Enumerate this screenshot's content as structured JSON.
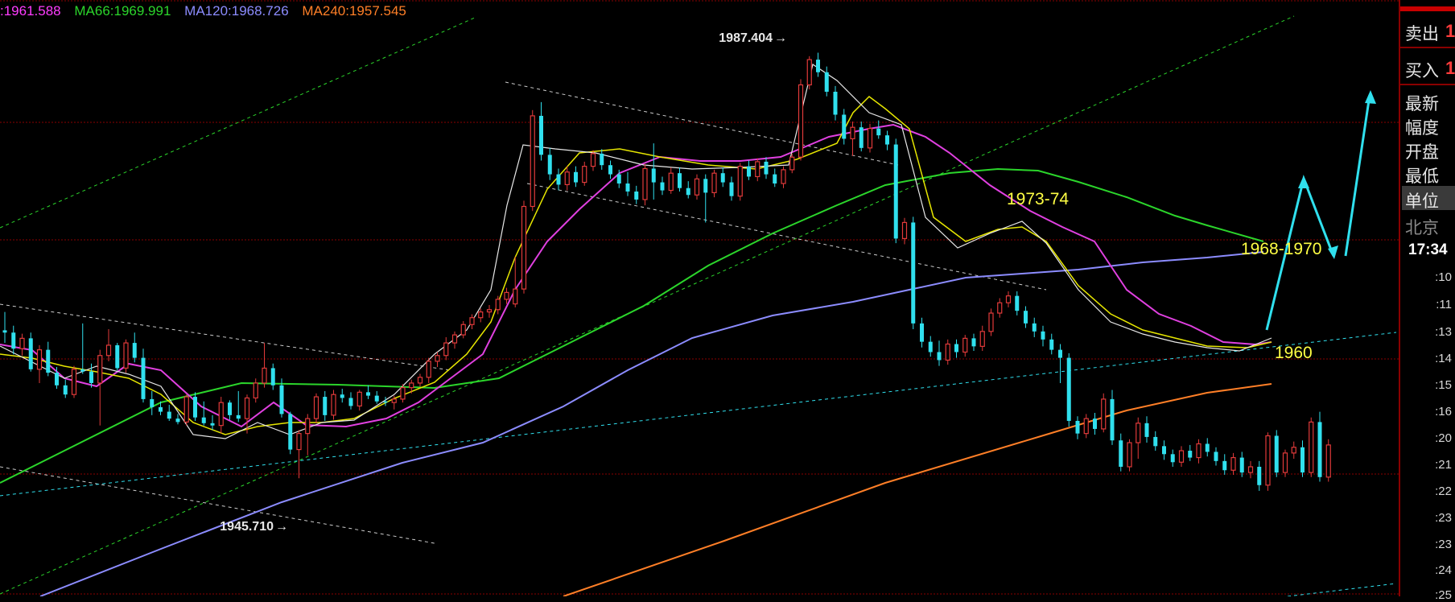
{
  "ma_legend": [
    {
      "text": ":1961.588",
      "color": "#ff3cff"
    },
    {
      "text": "MA66:1969.991",
      "color": "#2bd52b"
    },
    {
      "text": "MA120:1968.726",
      "color": "#8c8cff"
    },
    {
      "text": "MA240:1957.545",
      "color": "#ff7f27"
    }
  ],
  "price_labels": {
    "high": "1987.404",
    "low": "1945.710"
  },
  "annotations": {
    "a1": "1973-74",
    "a2": "1968-1970",
    "a3": "1960"
  },
  "side_panel": {
    "sell": "卖出",
    "buy": "买入",
    "sell_value": "1",
    "buy_value": "1",
    "latest": "最新",
    "change": "幅度",
    "open": "开盘",
    "low": "最低",
    "unit": "单位",
    "beijing": "北京",
    "time": "17:34",
    "ticks": [
      ":10",
      ":11",
      ":13",
      ":14",
      ":15",
      ":16",
      ":20",
      ":21",
      ":22",
      ":23",
      ":23",
      ":24",
      ":25"
    ]
  },
  "colors": {
    "background": "#000000",
    "up": "#e23a3a",
    "down": "#30e0ee",
    "grid": "#8a0000",
    "ma_white": "#e8e8e8",
    "ma_yellow": "#e6e600",
    "ma_magenta": "#e040e0",
    "ma66": "#2bd52b",
    "ma120": "#8c8cff",
    "ma240": "#ff7f27",
    "channel_green": "#2bd52b",
    "channel_white": "#cccccc",
    "trend_cyan": "#30e0ee",
    "annotation": "#ffff44",
    "arrow": "#30e0ee"
  },
  "chart_data": {
    "type": "candlestick",
    "instrument_price_range": [
      1940,
      1992
    ],
    "annotations": [
      "1987.404",
      "1945.710",
      "1973-74",
      "1968-1970",
      "1960"
    ],
    "ma_series": [
      {
        "name": "MA66",
        "last": 1969.991
      },
      {
        "name": "MA120",
        "last": 1968.726
      },
      {
        "name": "MA240",
        "last": 1957.545
      }
    ],
    "candles": [
      [
        1963.2,
        1964.8,
        1962.1,
        1963.0
      ],
      [
        1963.0,
        1963.6,
        1961.1,
        1961.6
      ],
      [
        1961.6,
        1962.9,
        1961.0,
        1962.5
      ],
      [
        1962.5,
        1963.0,
        1959.6,
        1959.8
      ],
      [
        1959.8,
        1961.9,
        1958.6,
        1961.5
      ],
      [
        1961.5,
        1962.2,
        1959.2,
        1959.5
      ],
      [
        1959.5,
        1960.0,
        1958.1,
        1958.4
      ],
      [
        1958.4,
        1958.9,
        1957.3,
        1957.6
      ],
      [
        1957.6,
        1960.1,
        1957.3,
        1959.8
      ],
      [
        1959.8,
        1963.8,
        1959.4,
        1959.6
      ],
      [
        1959.6,
        1960.3,
        1958.2,
        1958.6
      ],
      [
        1958.6,
        1961.5,
        1954.9,
        1961.0
      ],
      [
        1961.0,
        1963.3,
        1960.5,
        1961.9
      ],
      [
        1961.9,
        1962.1,
        1959.7,
        1959.9
      ],
      [
        1959.9,
        1962.4,
        1959.5,
        1962.1
      ],
      [
        1962.1,
        1963.0,
        1960.4,
        1960.8
      ],
      [
        1960.8,
        1961.6,
        1956.9,
        1957.2
      ],
      [
        1957.2,
        1957.9,
        1955.8,
        1956.5
      ],
      [
        1956.5,
        1957.0,
        1955.8,
        1956.1
      ],
      [
        1956.1,
        1956.7,
        1955.3,
        1955.5
      ],
      [
        1955.5,
        1955.9,
        1955.0,
        1955.2
      ],
      [
        1955.2,
        1957.6,
        1954.9,
        1957.4
      ],
      [
        1957.4,
        1957.8,
        1955.3,
        1955.6
      ],
      [
        1955.6,
        1957.0,
        1954.9,
        1955.1
      ],
      [
        1955.1,
        1955.8,
        1954.5,
        1954.9
      ],
      [
        1954.9,
        1957.4,
        1954.2,
        1956.9
      ],
      [
        1956.9,
        1957.1,
        1955.4,
        1955.8
      ],
      [
        1955.8,
        1957.9,
        1955.2,
        1955.5
      ],
      [
        1955.5,
        1957.6,
        1954.2,
        1957.3
      ],
      [
        1957.3,
        1959.0,
        1956.9,
        1958.6
      ],
      [
        1958.6,
        1962.1,
        1958.2,
        1959.9
      ],
      [
        1959.9,
        1960.3,
        1958.0,
        1958.4
      ],
      [
        1958.4,
        1959.0,
        1955.6,
        1955.9
      ],
      [
        1955.9,
        1956.1,
        1952.4,
        1952.8
      ],
      [
        1952.8,
        1954.5,
        1950.3,
        1954.2
      ],
      [
        1954.2,
        1955.9,
        1952.3,
        1955.5
      ],
      [
        1955.5,
        1957.7,
        1955.1,
        1957.4
      ],
      [
        1957.4,
        1957.9,
        1955.3,
        1955.8
      ],
      [
        1955.8,
        1958.0,
        1955.4,
        1957.6
      ],
      [
        1957.6,
        1958.1,
        1956.9,
        1957.3
      ],
      [
        1957.3,
        1957.8,
        1956.3,
        1956.6
      ],
      [
        1956.6,
        1958.0,
        1956.2,
        1957.8
      ],
      [
        1957.8,
        1958.4,
        1957.2,
        1957.5
      ],
      [
        1957.5,
        1957.9,
        1956.8,
        1957.0
      ],
      [
        1957.0,
        1957.4,
        1956.6,
        1956.9
      ],
      [
        1956.9,
        1957.5,
        1956.3,
        1957.2
      ],
      [
        1957.2,
        1958.5,
        1956.9,
        1958.2
      ],
      [
        1958.2,
        1958.9,
        1957.7,
        1958.6
      ],
      [
        1958.6,
        1959.4,
        1958.3,
        1959.1
      ],
      [
        1959.1,
        1960.8,
        1958.6,
        1960.5
      ],
      [
        1960.5,
        1961.3,
        1960.0,
        1961.0
      ],
      [
        1961.0,
        1962.6,
        1960.6,
        1962.1
      ],
      [
        1962.1,
        1963.1,
        1961.6,
        1962.8
      ],
      [
        1962.8,
        1964.0,
        1962.5,
        1963.7
      ],
      [
        1963.7,
        1964.6,
        1963.3,
        1964.3
      ],
      [
        1964.3,
        1965.1,
        1963.9,
        1964.8
      ],
      [
        1964.8,
        1965.4,
        1964.3,
        1965.0
      ],
      [
        1965.0,
        1966.2,
        1964.6,
        1965.9
      ],
      [
        1965.9,
        1966.9,
        1965.5,
        1966.5
      ],
      [
        1965.5,
        1969.6,
        1965.2,
        1966.8
      ],
      [
        1966.8,
        1974.5,
        1966.4,
        1974.0
      ],
      [
        1974.0,
        1982.4,
        1973.6,
        1981.9
      ],
      [
        1981.9,
        1983.1,
        1978.0,
        1978.5
      ],
      [
        1978.5,
        1979.1,
        1976.3,
        1976.8
      ],
      [
        1976.8,
        1977.3,
        1975.4,
        1975.9
      ],
      [
        1975.9,
        1977.5,
        1975.4,
        1977.0
      ],
      [
        1977.0,
        1977.5,
        1975.7,
        1976.1
      ],
      [
        1976.1,
        1977.9,
        1975.8,
        1977.5
      ],
      [
        1977.5,
        1978.9,
        1977.1,
        1978.6
      ],
      [
        1978.6,
        1979.0,
        1977.2,
        1977.6
      ],
      [
        1977.6,
        1978.0,
        1976.4,
        1976.8
      ],
      [
        1976.8,
        1977.2,
        1975.6,
        1976.0
      ],
      [
        1976.0,
        1977.0,
        1974.9,
        1975.3
      ],
      [
        1975.3,
        1975.8,
        1974.2,
        1974.6
      ],
      [
        1974.6,
        1977.7,
        1974.1,
        1977.3
      ],
      [
        1977.3,
        1979.5,
        1974.6,
        1976.1
      ],
      [
        1976.1,
        1976.6,
        1975.0,
        1975.4
      ],
      [
        1975.4,
        1977.4,
        1975.1,
        1976.9
      ],
      [
        1976.9,
        1977.4,
        1975.3,
        1975.6
      ],
      [
        1975.6,
        1976.2,
        1974.7,
        1975.0
      ],
      [
        1975.0,
        1976.8,
        1974.6,
        1976.4
      ],
      [
        1976.4,
        1976.8,
        1972.6,
        1975.2
      ],
      [
        1975.2,
        1977.2,
        1974.8,
        1976.9
      ],
      [
        1976.9,
        1977.4,
        1975.7,
        1976.1
      ],
      [
        1976.1,
        1976.6,
        1974.5,
        1974.9
      ],
      [
        1974.9,
        1977.8,
        1974.5,
        1977.5
      ],
      [
        1977.5,
        1978.0,
        1976.3,
        1976.6
      ],
      [
        1976.6,
        1978.2,
        1976.2,
        1977.9
      ],
      [
        1977.9,
        1978.3,
        1976.4,
        1976.8
      ],
      [
        1976.8,
        1977.3,
        1975.7,
        1976.0
      ],
      [
        1976.0,
        1977.5,
        1975.6,
        1977.2
      ],
      [
        1977.2,
        1978.6,
        1976.9,
        1978.3
      ],
      [
        1978.3,
        1985.1,
        1978.0,
        1984.6
      ],
      [
        1984.6,
        1987.1,
        1984.2,
        1986.8
      ],
      [
        1986.8,
        1987.4,
        1985.3,
        1985.7
      ],
      [
        1985.7,
        1986.2,
        1983.6,
        1984.0
      ],
      [
        1984.0,
        1984.5,
        1981.5,
        1982.0
      ],
      [
        1982.0,
        1982.5,
        1979.4,
        1979.9
      ],
      [
        1979.9,
        1981.4,
        1978.4,
        1980.9
      ],
      [
        1980.9,
        1981.4,
        1978.8,
        1979.1
      ],
      [
        1979.1,
        1981.2,
        1978.7,
        1980.8
      ],
      [
        1980.8,
        1981.5,
        1979.9,
        1980.2
      ],
      [
        1980.2,
        1980.6,
        1978.9,
        1979.4
      ],
      [
        1979.4,
        1979.9,
        1970.8,
        1971.2
      ],
      [
        1971.2,
        1973.0,
        1970.7,
        1972.6
      ],
      [
        1972.6,
        1973.1,
        1963.3,
        1963.8
      ],
      [
        1963.8,
        1964.3,
        1961.7,
        1962.2
      ],
      [
        1962.2,
        1962.7,
        1960.9,
        1961.3
      ],
      [
        1961.3,
        1962.3,
        1960.1,
        1960.6
      ],
      [
        1960.6,
        1962.4,
        1960.2,
        1962.0
      ],
      [
        1962.0,
        1962.4,
        1960.8,
        1961.3
      ],
      [
        1961.3,
        1962.8,
        1960.9,
        1962.5
      ],
      [
        1962.5,
        1962.9,
        1961.4,
        1961.8
      ],
      [
        1961.8,
        1963.6,
        1961.4,
        1963.1
      ],
      [
        1963.1,
        1965.1,
        1962.7,
        1964.7
      ],
      [
        1964.7,
        1966.0,
        1964.3,
        1965.6
      ],
      [
        1965.6,
        1966.6,
        1965.2,
        1966.2
      ],
      [
        1966.2,
        1966.6,
        1964.5,
        1964.9
      ],
      [
        1964.9,
        1965.3,
        1963.4,
        1963.8
      ],
      [
        1963.8,
        1964.3,
        1962.6,
        1963.1
      ],
      [
        1963.1,
        1963.6,
        1961.8,
        1962.4
      ],
      [
        1962.4,
        1962.9,
        1961.1,
        1961.5
      ],
      [
        1961.5,
        1962.0,
        1958.6,
        1960.8
      ],
      [
        1960.8,
        1961.2,
        1954.8,
        1955.3
      ],
      [
        1955.3,
        1955.7,
        1953.7,
        1954.2
      ],
      [
        1954.2,
        1955.9,
        1953.8,
        1955.5
      ],
      [
        1955.5,
        1956.0,
        1954.1,
        1954.6
      ],
      [
        1954.6,
        1957.7,
        1954.3,
        1957.2
      ],
      [
        1957.2,
        1958.0,
        1953.2,
        1953.6
      ],
      [
        1953.6,
        1954.2,
        1950.9,
        1951.3
      ],
      [
        1951.3,
        1953.7,
        1950.9,
        1953.4
      ],
      [
        1953.4,
        1955.6,
        1952.0,
        1955.1
      ],
      [
        1955.1,
        1955.7,
        1953.4,
        1953.9
      ],
      [
        1953.9,
        1954.4,
        1952.7,
        1953.1
      ],
      [
        1953.1,
        1953.6,
        1951.9,
        1952.4
      ],
      [
        1952.4,
        1952.8,
        1951.3,
        1951.7
      ],
      [
        1951.7,
        1953.1,
        1951.3,
        1952.7
      ],
      [
        1952.7,
        1953.2,
        1951.8,
        1952.1
      ],
      [
        1952.1,
        1953.7,
        1951.6,
        1953.3
      ],
      [
        1953.3,
        1953.8,
        1952.2,
        1952.6
      ],
      [
        1952.6,
        1953.0,
        1951.4,
        1951.8
      ],
      [
        1951.8,
        1952.4,
        1950.6,
        1951.0
      ],
      [
        1951.0,
        1952.5,
        1950.6,
        1952.1
      ],
      [
        1952.1,
        1952.6,
        1950.4,
        1950.8
      ],
      [
        1950.8,
        1951.8,
        1950.3,
        1951.3
      ],
      [
        1951.3,
        1951.8,
        1949.2,
        1949.7
      ],
      [
        1949.7,
        1954.3,
        1949.2,
        1954.0
      ],
      [
        1954.0,
        1954.5,
        1950.4,
        1950.8
      ],
      [
        1950.8,
        1952.8,
        1950.4,
        1952.5
      ],
      [
        1952.5,
        1953.5,
        1952.0,
        1953.0
      ],
      [
        1953.0,
        1953.6,
        1950.4,
        1950.8
      ],
      [
        1950.8,
        1955.6,
        1950.4,
        1955.2
      ],
      [
        1955.2,
        1956.1,
        1950.0,
        1950.4
      ],
      [
        1950.4,
        1953.7,
        1950.0,
        1953.2
      ]
    ]
  }
}
